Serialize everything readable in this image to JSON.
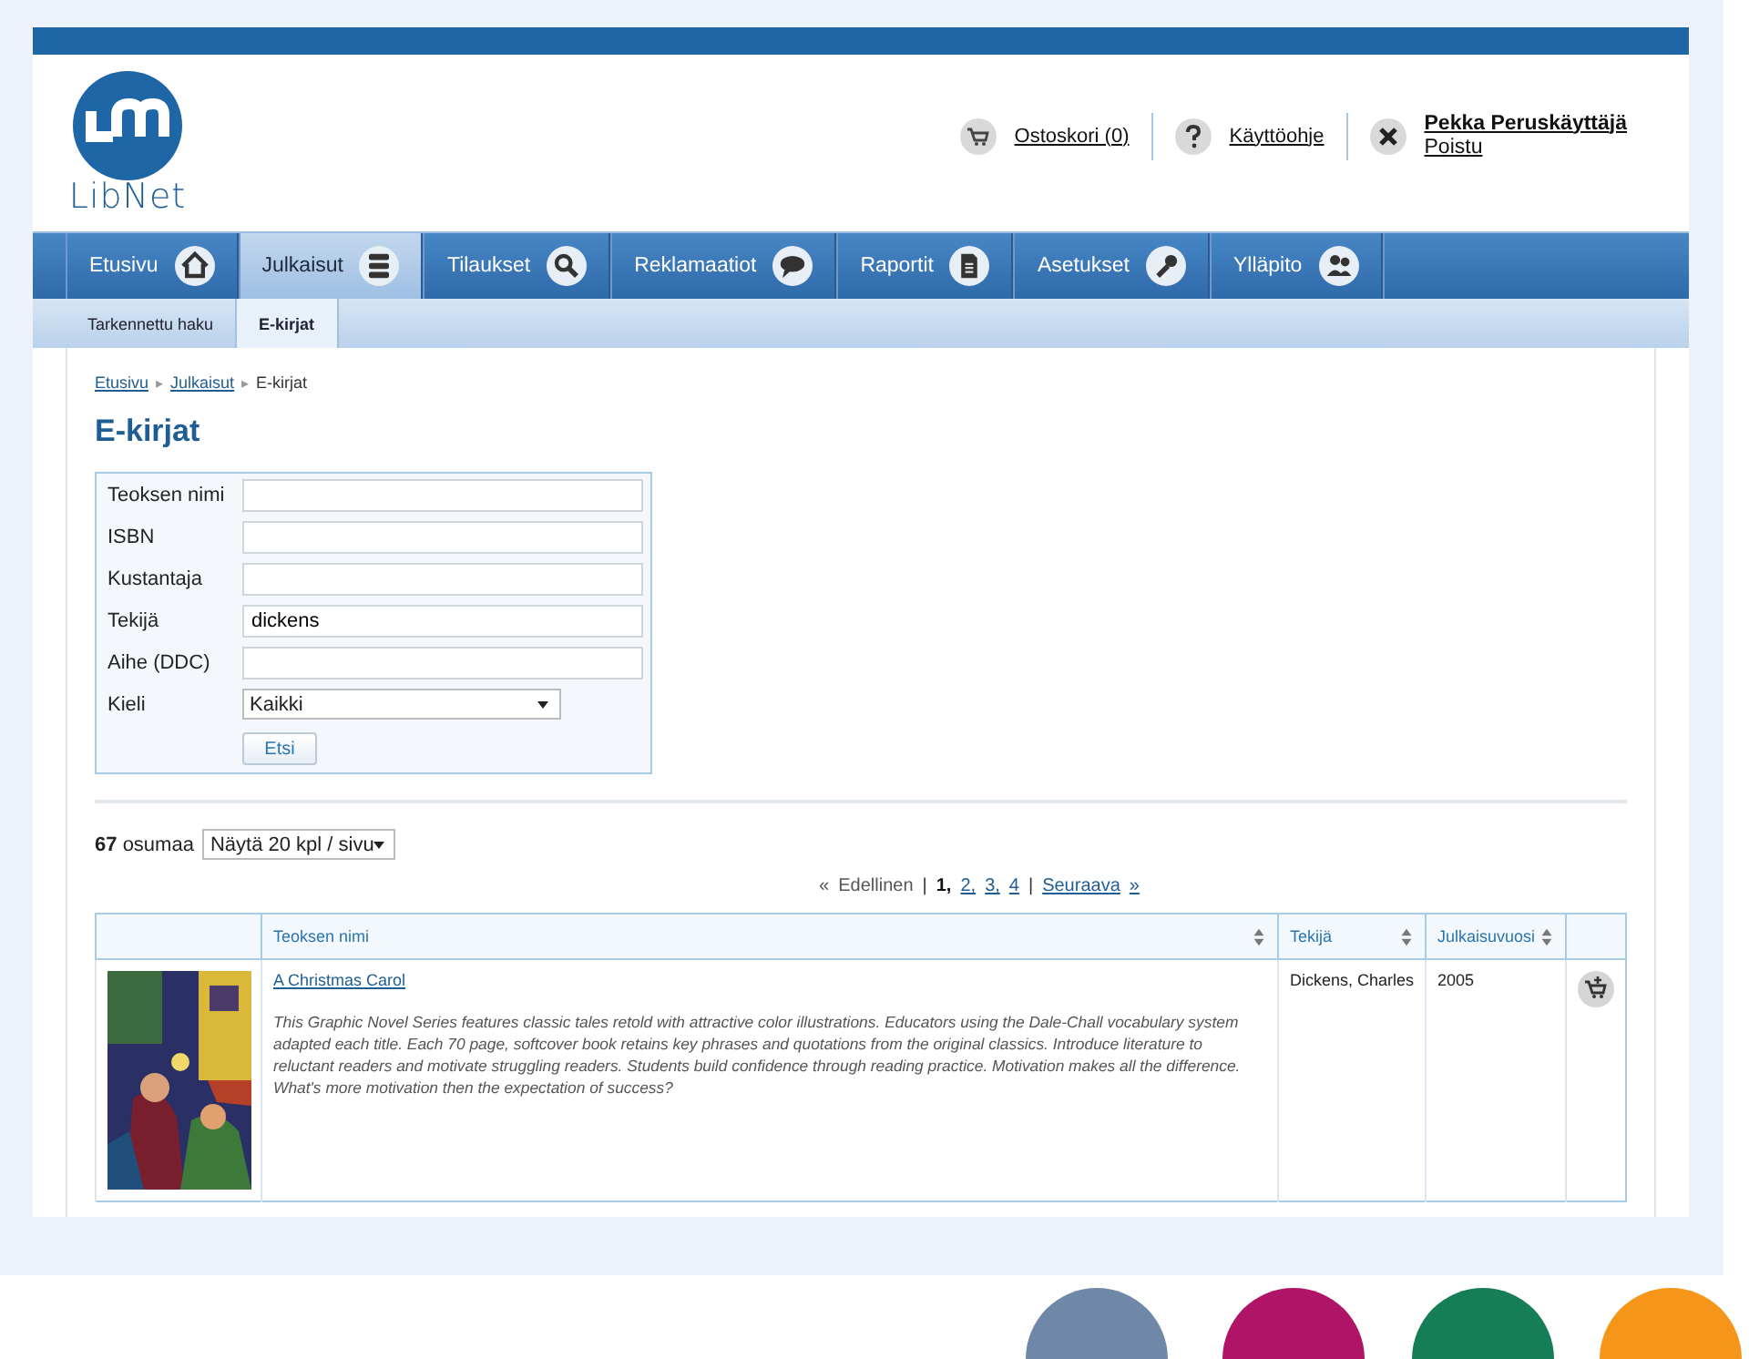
{
  "logo": {
    "text": "LibNet"
  },
  "header_links": [
    {
      "kind": "cart",
      "label": "Ostoskori (0)"
    },
    {
      "kind": "help",
      "label": "Käyttöohje"
    },
    {
      "kind": "user",
      "label": "Pekka Peruskäyttäjä",
      "sublabel": "Poistu"
    }
  ],
  "nav": [
    {
      "label": "Etusivu",
      "selected": false
    },
    {
      "label": "Julkaisut",
      "selected": true
    },
    {
      "label": "Tilaukset",
      "selected": false
    },
    {
      "label": "Reklamaatiot",
      "selected": false
    },
    {
      "label": "Raportit",
      "selected": false
    },
    {
      "label": "Asetukset",
      "selected": false
    },
    {
      "label": "Ylläpito",
      "selected": false
    }
  ],
  "subnav": [
    {
      "label": "Tarkennettu haku",
      "selected": false
    },
    {
      "label": "E-kirjat",
      "selected": true
    }
  ],
  "breadcrumb": [
    {
      "label": "Etusivu",
      "link": true
    },
    {
      "separator": "▸",
      "label": "Julkaisut",
      "link": true
    },
    {
      "separator": "▸",
      "label": "E-kirjat",
      "link": false
    }
  ],
  "title": "E-kirjat",
  "form": {
    "fields": [
      {
        "kind": "text",
        "label": "Teoksen nimi"
      },
      {
        "kind": "text",
        "label": "ISBN"
      },
      {
        "kind": "text",
        "label": "Kustantaja"
      },
      {
        "kind": "text",
        "label": "Tekijä",
        "value": "dickens"
      },
      {
        "kind": "text",
        "label": "Aihe (DDC)"
      },
      {
        "kind": "select",
        "label": "Kieli",
        "value": "Kaikki"
      }
    ],
    "button": "Etsi"
  },
  "results": {
    "count": "67",
    "count_label": "osumaa",
    "page_size": "Näytä 20 kpl / sivu"
  },
  "pagination": {
    "prev_icon": "«",
    "prev": "Edellinen",
    "separators": [
      "|",
      "|"
    ],
    "pages": [
      {
        "label": "1,",
        "selected": true
      },
      {
        "label": "2,",
        "selected": false
      },
      {
        "label": "3,",
        "selected": false
      },
      {
        "label": "4",
        "selected": false
      }
    ],
    "next": "Seuraava",
    "next_icon": "»"
  },
  "table": {
    "columns": [
      {
        "sortable": false
      },
      {
        "label": "Teoksen nimi",
        "sortable": true
      },
      {
        "label": "Tekijä",
        "sortable": true
      },
      {
        "label": "Julkaisuvuosi",
        "sortable": true
      },
      {
        "sortable": false
      }
    ],
    "rows": [
      {
        "title": "A Christmas Carol",
        "description": "This Graphic Novel Series features classic tales retold with attractive color illustrations. Educators using the Dale-Chall vocabulary system adapted each title. Each 70 page, softcover book retains key phrases and quotations from the original classics. Introduce literature to reluctant readers and motivate struggling readers. Students build confidence through reading practice. Motivation makes all the difference. What's more motivation then the expectation of success?",
        "author": "Dickens, Charles",
        "year": "2005"
      }
    ]
  },
  "decorations": [
    {
      "color": "#7088a8"
    },
    {
      "color": "#b01466"
    },
    {
      "color": "#167e56"
    },
    {
      "color": "#f5951a"
    }
  ]
}
